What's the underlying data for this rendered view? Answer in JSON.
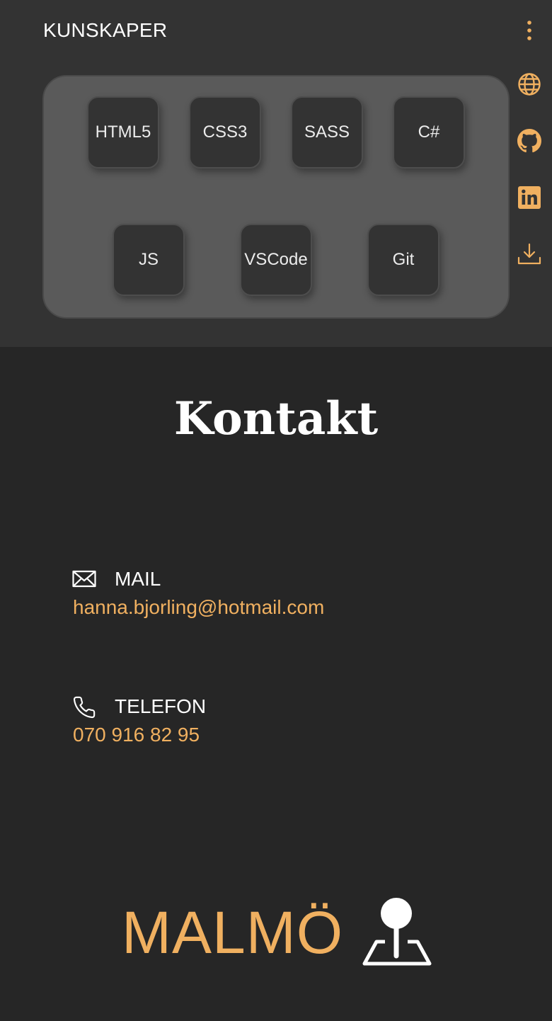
{
  "skills": {
    "heading": "KUNSKAPER",
    "items": [
      "HTML5",
      "CSS3",
      "SASS",
      "C#",
      "JS",
      "VSCode",
      "Git"
    ]
  },
  "side_nav": {
    "icons": [
      "more-vertical-icon",
      "globe-icon",
      "github-icon",
      "linkedin-icon",
      "download-icon"
    ]
  },
  "contact": {
    "title": "Kontakt",
    "mail": {
      "icon": "envelope-icon",
      "label": "MAIL",
      "value": "hanna.bjorling@hotmail.com"
    },
    "phone": {
      "icon": "phone-icon",
      "label": "TELEFON",
      "value": "070 916 82 95"
    },
    "city": "MALMÖ",
    "city_icon": "map-pin-icon"
  },
  "colors": {
    "accent": "#f0b060",
    "background": "#262626",
    "top_section": "#333333",
    "panel": "#5a5a5a",
    "tile": "#333333",
    "text": "#ffffff"
  }
}
